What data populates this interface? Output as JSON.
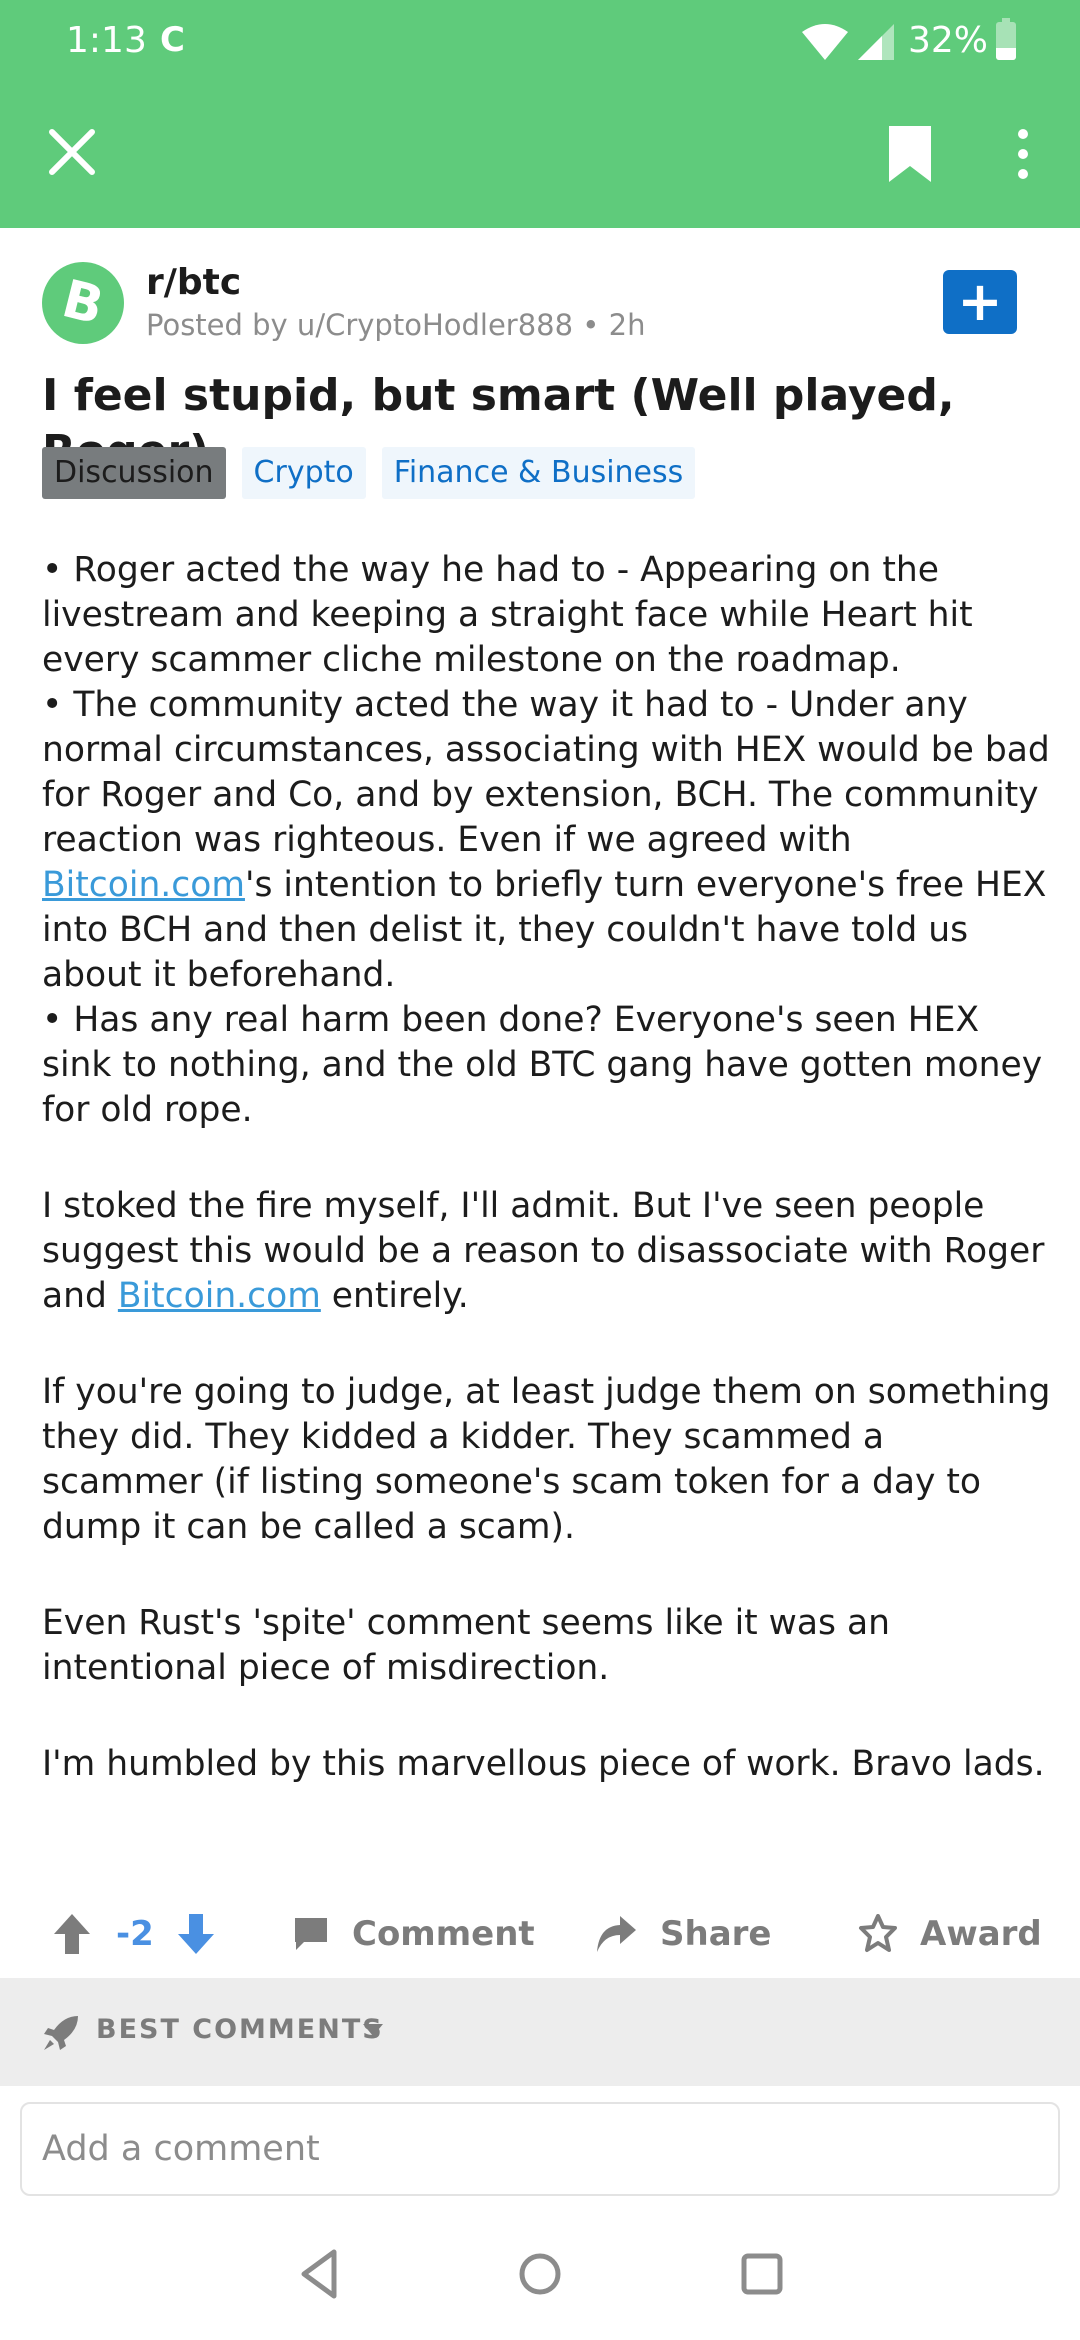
{
  "status_bar": {
    "time": "1:13",
    "sync_glyph": "C",
    "battery": "32%",
    "battery_level": 0.32
  },
  "app_bar": {
    "close_icon": "close-icon",
    "bookmark_icon": "bookmark-icon",
    "more_icon": "more-vert-icon",
    "color": "#5fcb7b"
  },
  "post": {
    "subreddit": "r/btc",
    "subreddit_icon_letter": "B",
    "posted_by": "Posted by u/CryptoHodler888 • 2h",
    "join_label": "+",
    "title": "I feel stupid, but smart (Well played, Roger)",
    "flairs": [
      "Discussion",
      "Crypto",
      "Finance & Business"
    ],
    "body": {
      "bullet1": "• Roger acted the way he had to - Appearing on the livestream and keeping a straight face while Heart hit every scammer cliche milestone on the roadmap.",
      "bullet2_pre": "• The community acted the way it had to - Under any normal circumstances, associating with HEX would be bad for Roger and Co, and by extension, BCH. The community reaction was righteous. Even if we agreed with ",
      "bullet2_link": "Bitcoin.com",
      "bullet2_post": "'s intention to briefly turn everyone's free HEX into BCH and then delist it, they couldn't have told us about it beforehand.",
      "bullet3": "• Has any real harm been done? Everyone's seen HEX sink to nothing, and the old BTC gang have gotten money for old rope.",
      "para2_pre": "I stoked the fire myself, I'll admit. But I've seen people suggest this would be a reason to disassociate with Roger and ",
      "para2_link": "Bitcoin.com",
      "para2_post": " entirely.",
      "para3": "If you're going to judge, at least judge them on something they did. They kidded a kidder. They scammed a scammer (if listing someone's scam token for a day to dump it can be called a scam).",
      "para4": "Even Rust's 'spite' comment seems like it was an intentional piece of misdirection.",
      "para5": "I'm humbled by this marvellous piece of work. Bravo lads."
    }
  },
  "actions": {
    "score": "-2",
    "comment_label": "Comment",
    "share_label": "Share",
    "award_label": "Award"
  },
  "comments": {
    "sort_label": "BEST COMMENTS",
    "input_placeholder": "Add a comment"
  },
  "colors": {
    "accent_green": "#5fcb7b",
    "link_blue": "#3a9ad9",
    "button_blue": "#0f6fc6",
    "vote_blue": "#4a90e2"
  }
}
